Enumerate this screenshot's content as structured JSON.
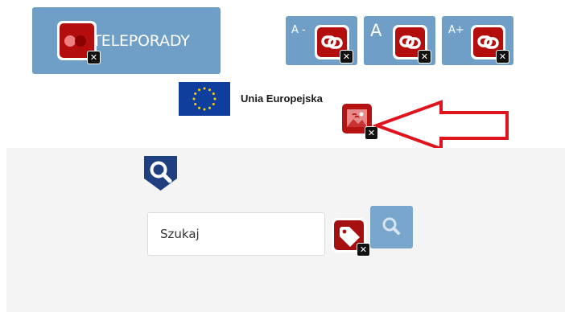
{
  "header": {
    "teleporady_label": "TELEPORADY",
    "font_size": {
      "decrease_label": "A -",
      "normal_label": "A",
      "increase_label": "A+"
    }
  },
  "eu": {
    "label": "Unia Europejska"
  },
  "search": {
    "placeholder": "Szukaj"
  },
  "icons": {
    "teleporady_icon": "wave-error-icon",
    "font_decrease_icon": "broken-link-icon",
    "font_normal_icon": "broken-link-icon",
    "font_increase_icon": "broken-link-icon",
    "eu_image_icon": "missing-alt-image-icon",
    "search_field_icon": "missing-label-tag-icon",
    "search_button_icon": "magnifier-icon",
    "shield_icon": "magnifier-shield-icon"
  },
  "colors": {
    "button_blue": "#6f9fc6",
    "wave_red": "#b30d0d",
    "arrow_red": "#e0141e",
    "eu_blue": "#0f3e9c",
    "eu_star": "#ffd200",
    "grey_panel": "#f4f4f4"
  }
}
